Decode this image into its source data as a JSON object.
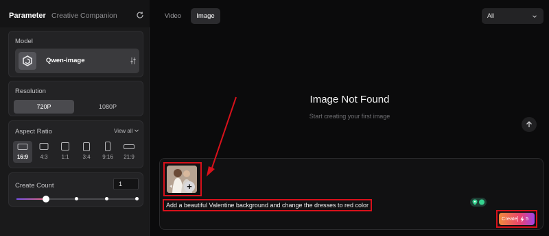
{
  "sidebar": {
    "tabs": [
      "Parameter",
      "Creative Companion"
    ],
    "model": {
      "label": "Model",
      "name": "Qwen-image"
    },
    "resolution": {
      "label": "Resolution",
      "options": [
        "720P",
        "1080P"
      ],
      "selected": "720P"
    },
    "aspect_ratio": {
      "label": "Aspect Ratio",
      "view_all": "View all",
      "options": [
        "16:9",
        "4:3",
        "1:1",
        "3:4",
        "9:16",
        "21:9"
      ],
      "selected": "16:9"
    },
    "create_count": {
      "label": "Create Count",
      "value": "1",
      "slider_fraction": 0.25
    }
  },
  "main": {
    "tabs": [
      "Video",
      "Image"
    ],
    "active_tab": "Image",
    "filter": "All",
    "empty_title": "Image Not Found",
    "empty_subtitle": "Start creating your first image",
    "prompt": "Add a beautiful Valentine background and change the dresses to red color",
    "create": {
      "label": "Create",
      "cost": "5"
    }
  },
  "colors": {
    "annotation_red": "#d8111b",
    "create_gradient": [
      "#f08a3c",
      "#e9426e",
      "#a143e6"
    ]
  }
}
